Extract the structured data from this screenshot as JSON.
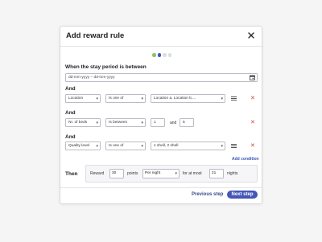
{
  "modal": {
    "title": "Add reward rule",
    "close_icon": "close-icon"
  },
  "stepper": {
    "steps": 4,
    "current": 2,
    "colors": [
      "#8ac46a",
      "#4456b8",
      "#dcdde0",
      "#dcdde0"
    ]
  },
  "period": {
    "label": "When the stay period is between",
    "date_range_value": "dd-mm-yyyy – dd-mm-yyyy",
    "calendar_icon": "calendar-icon"
  },
  "conditions": [
    {
      "connector": "And",
      "attribute": "Location",
      "operator": "Is one of",
      "value": "Location a, Location b,..."
    },
    {
      "connector": "And",
      "attribute": "Nr. of beds",
      "operator": "Is between",
      "value_min": "1",
      "joiner": "and",
      "value_max": "5"
    },
    {
      "connector": "And",
      "attribute": "Quality level",
      "operator": "Is one of",
      "value": "1 shell, 2 shell"
    }
  ],
  "add_condition_label": "Add condition",
  "then": {
    "label": "Then",
    "reward_label": "Reward",
    "points_value": "30",
    "points_label": "points",
    "frequency": "Per night",
    "at_most_label": "for at most",
    "nights_value": "21",
    "nights_label": "nights"
  },
  "footer": {
    "previous_label": "Previous step",
    "next_label": "Next step"
  }
}
